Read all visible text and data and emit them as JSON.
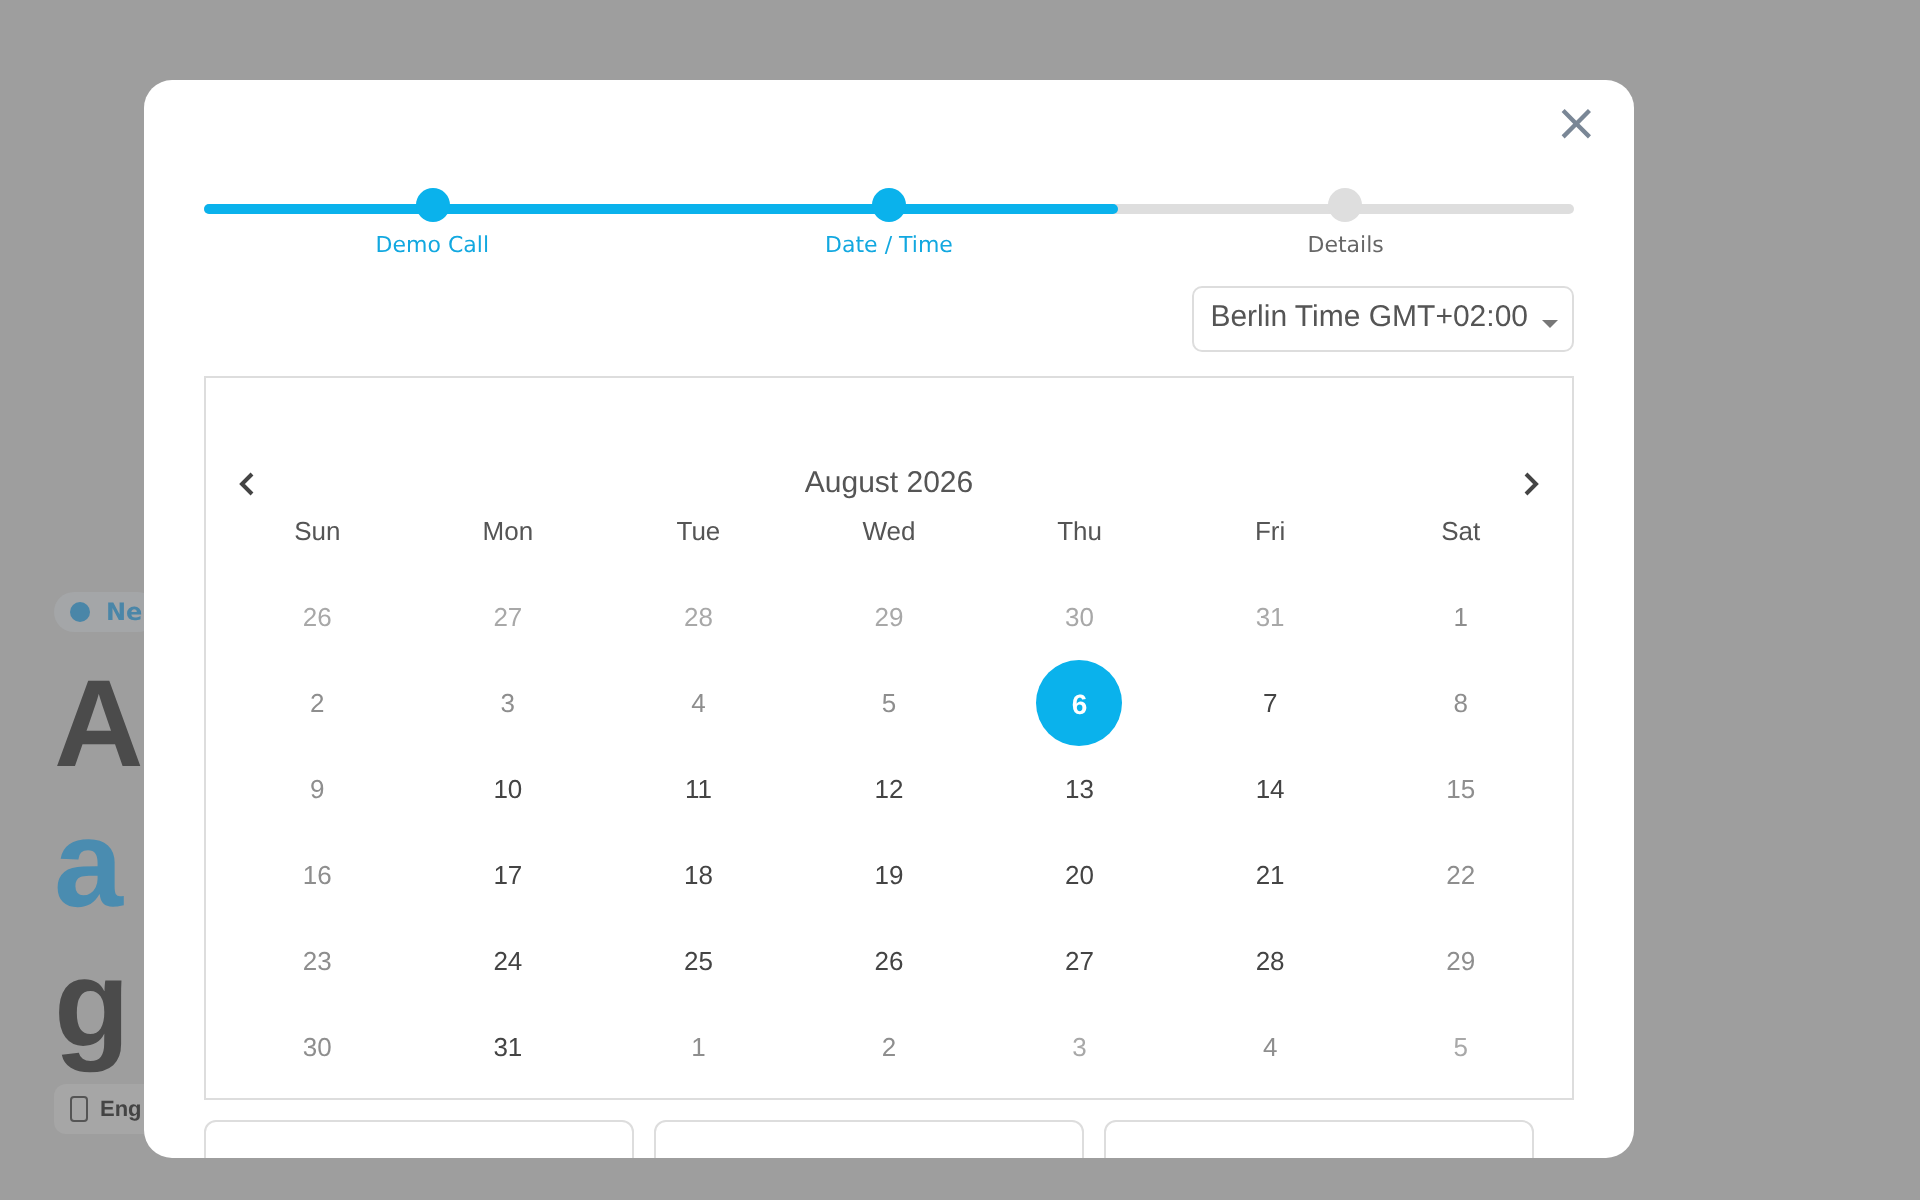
{
  "background": {
    "badge": "Ne",
    "headline": [
      {
        "text": "A",
        "accent": false
      },
      {
        "text": "a",
        "accent": true
      },
      {
        "text": "g",
        "accent": false
      }
    ],
    "button": "Eng"
  },
  "modal": {
    "close": "×",
    "steps": [
      {
        "label": "Demo Call",
        "reached": true
      },
      {
        "label": "Date / Time",
        "reached": true
      },
      {
        "label": "Details",
        "reached": false
      }
    ],
    "progress": {
      "level": 0.667
    },
    "timezone": {
      "value": "Berlin Time GMT+02:00"
    },
    "calendar": {
      "month": "August 2026",
      "weekdays": [
        "Sun",
        "Mon",
        "Tue",
        "Wed",
        "Thu",
        "Fri",
        "Sat"
      ],
      "weeks": [
        [
          {
            "day": "26",
            "faded": true,
            "available": false,
            "selected": false
          },
          {
            "day": "27",
            "faded": true,
            "available": false,
            "selected": false
          },
          {
            "day": "28",
            "faded": true,
            "available": false,
            "selected": false
          },
          {
            "day": "29",
            "faded": true,
            "available": false,
            "selected": false
          },
          {
            "day": "30",
            "faded": true,
            "available": false,
            "selected": false
          },
          {
            "day": "31",
            "faded": true,
            "available": false,
            "selected": false
          },
          {
            "day": "1",
            "faded": false,
            "available": false,
            "selected": false
          }
        ],
        [
          {
            "day": "2",
            "faded": false,
            "available": false,
            "selected": false
          },
          {
            "day": "3",
            "faded": false,
            "available": false,
            "selected": false
          },
          {
            "day": "4",
            "faded": false,
            "available": false,
            "selected": false
          },
          {
            "day": "5",
            "faded": false,
            "available": false,
            "selected": false
          },
          {
            "day": "6",
            "faded": false,
            "available": true,
            "selected": true
          },
          {
            "day": "7",
            "faded": false,
            "available": true,
            "selected": false
          },
          {
            "day": "8",
            "faded": false,
            "available": false,
            "selected": false
          }
        ],
        [
          {
            "day": "9",
            "faded": false,
            "available": false,
            "selected": false
          },
          {
            "day": "10",
            "faded": false,
            "available": true,
            "selected": false
          },
          {
            "day": "11",
            "faded": false,
            "available": true,
            "selected": false
          },
          {
            "day": "12",
            "faded": false,
            "available": true,
            "selected": false
          },
          {
            "day": "13",
            "faded": false,
            "available": true,
            "selected": false
          },
          {
            "day": "14",
            "faded": false,
            "available": true,
            "selected": false
          },
          {
            "day": "15",
            "faded": false,
            "available": false,
            "selected": false
          }
        ],
        [
          {
            "day": "16",
            "faded": false,
            "available": false,
            "selected": false
          },
          {
            "day": "17",
            "faded": false,
            "available": true,
            "selected": false
          },
          {
            "day": "18",
            "faded": false,
            "available": true,
            "selected": false
          },
          {
            "day": "19",
            "faded": false,
            "available": true,
            "selected": false
          },
          {
            "day": "20",
            "faded": false,
            "available": true,
            "selected": false
          },
          {
            "day": "21",
            "faded": false,
            "available": true,
            "selected": false
          },
          {
            "day": "22",
            "faded": false,
            "available": false,
            "selected": false
          }
        ],
        [
          {
            "day": "23",
            "faded": false,
            "available": false,
            "selected": false
          },
          {
            "day": "24",
            "faded": false,
            "available": true,
            "selected": false
          },
          {
            "day": "25",
            "faded": false,
            "available": true,
            "selected": false
          },
          {
            "day": "26",
            "faded": false,
            "available": true,
            "selected": false
          },
          {
            "day": "27",
            "faded": false,
            "available": true,
            "selected": false
          },
          {
            "day": "28",
            "faded": false,
            "available": true,
            "selected": false
          },
          {
            "day": "29",
            "faded": false,
            "available": false,
            "selected": false
          }
        ],
        [
          {
            "day": "30",
            "faded": false,
            "available": false,
            "selected": false
          },
          {
            "day": "31",
            "faded": false,
            "available": true,
            "selected": false
          },
          {
            "day": "1",
            "faded": false,
            "available": false,
            "selected": false
          },
          {
            "day": "2",
            "faded": false,
            "available": false,
            "selected": false
          },
          {
            "day": "3",
            "faded": true,
            "available": false,
            "selected": false
          },
          {
            "day": "4",
            "faded": false,
            "available": false,
            "selected": false
          },
          {
            "day": "5",
            "faded": true,
            "available": false,
            "selected": false
          }
        ]
      ]
    },
    "fields": [
      {
        "kind": "input"
      },
      {
        "kind": "input"
      },
      {
        "kind": "input"
      }
    ]
  }
}
